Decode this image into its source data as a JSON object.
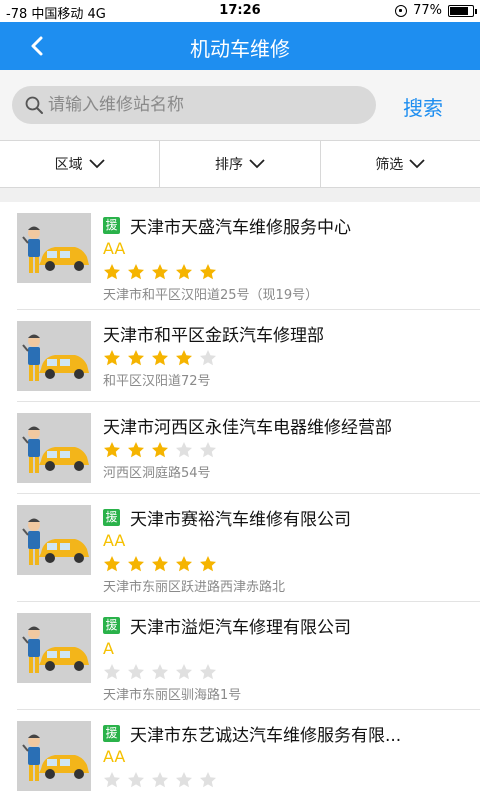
{
  "status_bar": {
    "signal": "-78",
    "carrier": "中国移动",
    "network": "4G",
    "time": "17:26",
    "battery": "77%",
    "battery_level": 0.77
  },
  "header": {
    "title": "机动车维修",
    "back_icon": "chevron-left-icon"
  },
  "search": {
    "placeholder": "请输入维修站名称",
    "value": "",
    "button_label": "搜索"
  },
  "filters": [
    {
      "label": "区域"
    },
    {
      "label": "排序"
    },
    {
      "label": "筛选"
    }
  ],
  "colors": {
    "primary": "#1e8ef0",
    "badge": "#2ab24a",
    "grade": "#f5c000",
    "star_on": "#f5b400",
    "star_off": "#e0e0e0"
  },
  "shops": [
    {
      "badge": "援",
      "name": "天津市天盛汽车维修服务中心",
      "grade": "AA",
      "stars": 5,
      "address": "天津市和平区汉阳道25号（现19号）"
    },
    {
      "badge": "",
      "name": "天津市和平区金跃汽车修理部",
      "grade": "",
      "stars": 4,
      "address": "和平区汉阳道72号"
    },
    {
      "badge": "",
      "name": "天津市河西区永佳汽车电器维修经营部",
      "grade": "",
      "stars": 3,
      "address": "河西区洞庭路54号"
    },
    {
      "badge": "援",
      "name": "天津市赛裕汽车维修有限公司",
      "grade": "AA",
      "stars": 5,
      "address": "天津市东丽区跃进路西津赤路北"
    },
    {
      "badge": "援",
      "name": "天津市溢炬汽车修理有限公司",
      "grade": "A",
      "stars": 0,
      "address": "天津市东丽区驯海路1号"
    },
    {
      "badge": "援",
      "name": "天津市东艺诚达汽车维修服务有限...",
      "grade": "AA",
      "stars": 0,
      "address": ""
    }
  ]
}
